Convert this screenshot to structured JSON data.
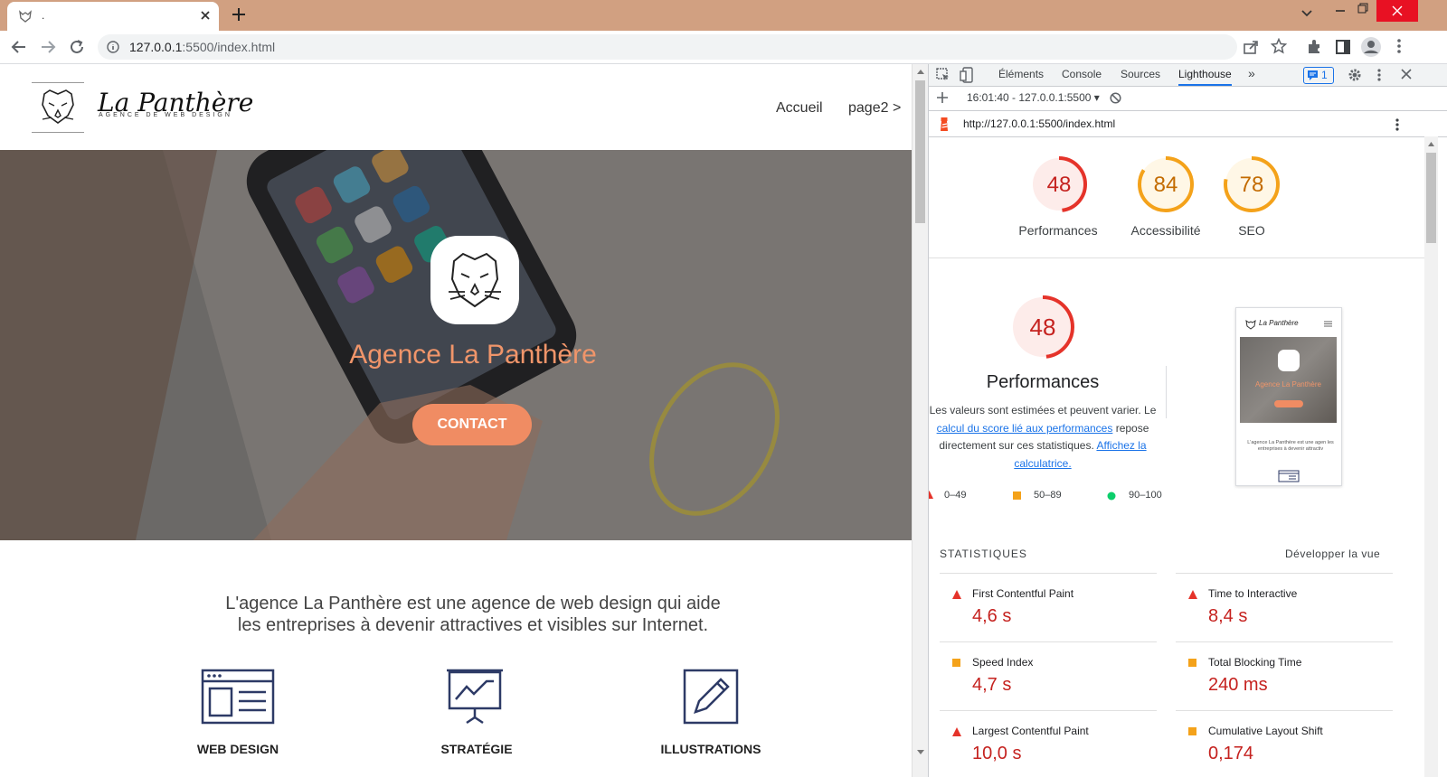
{
  "browser": {
    "tab_title": ".",
    "url_host": "127.0.0.1",
    "url_rest": ":5500/index.html"
  },
  "site": {
    "logo_title": "La Panthère",
    "logo_subtitle": "AGENCE DE WEB DESIGN",
    "nav": [
      "Accueil",
      "page2 >"
    ],
    "hero_title": "Agence La Panthère",
    "hero_button": "CONTACT",
    "tagline_line1": "L'agence La Panthère est une agence de web design qui aide",
    "tagline_line2": "les entreprises à devenir attractives et visibles sur Internet.",
    "services": [
      "WEB DESIGN",
      "STRATÉGIE",
      "ILLUSTRATIONS"
    ]
  },
  "devtools": {
    "tabs": [
      "Éléments",
      "Console",
      "Sources",
      "Lighthouse"
    ],
    "active_tab": "Lighthouse",
    "issues_count": "1",
    "report_selector": "16:01:40 - 127.0.0.1:5500",
    "report_url": "http://127.0.0.1:5500/index.html",
    "scores": [
      {
        "label": "Performances",
        "value": 48,
        "color": "#e5332a"
      },
      {
        "label": "Accessibilité",
        "value": 84,
        "color": "#f4a21a"
      },
      {
        "label": "SEO",
        "value": 78,
        "color": "#f4a21a"
      }
    ],
    "perf_title": "Performances",
    "perf_score": 48,
    "perf_desc_1": "Les valeurs sont estimées et peuvent varier. Le",
    "perf_desc_link1": "calcul du score lié aux performances",
    "perf_desc_2": "repose directement sur ces statistiques.",
    "perf_desc_link2": "Affichez la calculatrice.",
    "legend": [
      "0–49",
      "50–89",
      "90–100"
    ],
    "thumb_site_title": "La Panthère",
    "thumb_hero_title": "Agence La Panthère",
    "thumb_tagline": "L'agence La Panthère est une agen les entreprises à devenir attractiv",
    "stats_title": "STATISTIQUES",
    "stats_expand": "Développer la vue",
    "metrics": [
      {
        "name": "First Contentful Paint",
        "value": "4,6 s",
        "status": "fail"
      },
      {
        "name": "Time to Interactive",
        "value": "8,4 s",
        "status": "fail"
      },
      {
        "name": "Speed Index",
        "value": "4,7 s",
        "status": "average"
      },
      {
        "name": "Total Blocking Time",
        "value": "240 ms",
        "status": "average"
      },
      {
        "name": "Largest Contentful Paint",
        "value": "10,0 s",
        "status": "fail"
      },
      {
        "name": "Cumulative Layout Shift",
        "value": "0,174",
        "status": "average"
      }
    ],
    "colors": {
      "fail": "#e5332a",
      "average": "#f4a21a",
      "pass": "#0cce6b",
      "link": "#1a73e8"
    }
  }
}
